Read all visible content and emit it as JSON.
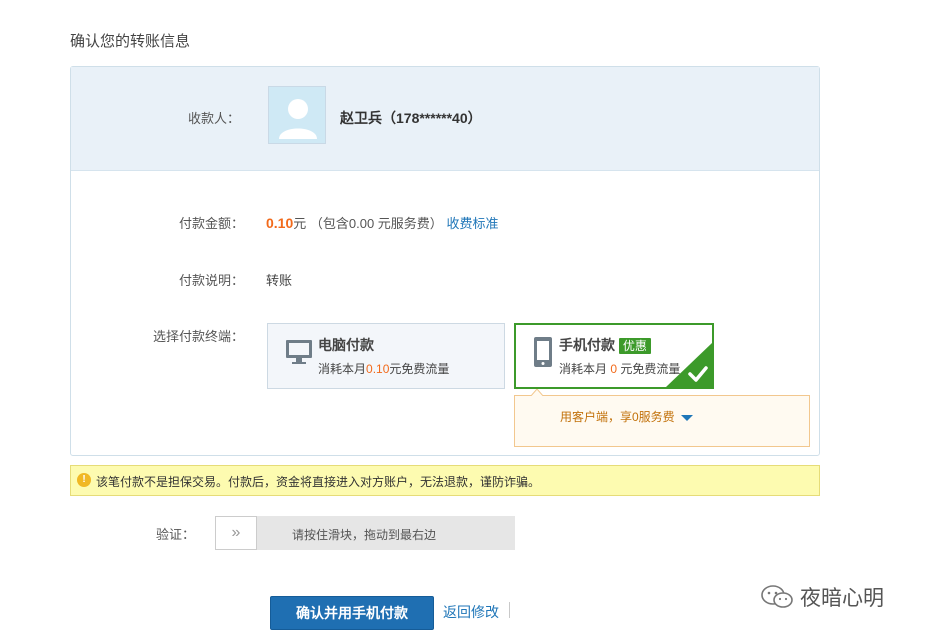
{
  "page": {
    "title": "确认您的转账信息"
  },
  "payee": {
    "label": "收款人：",
    "name": "赵卫兵（178******40）"
  },
  "amount": {
    "label": "付款金额：",
    "value": "0.10",
    "unit": "元",
    "fee_note": "（包含0.00 元服务费）",
    "fee_link": "收费标准"
  },
  "note": {
    "label": "付款说明：",
    "value": "转账"
  },
  "terminal": {
    "label": "选择付款终端：",
    "options": [
      {
        "title": "电脑付款",
        "sub_prefix": "消耗本月",
        "sub_value": "0.10",
        "sub_suffix": "元免费流量",
        "selected": false,
        "icon": "monitor-icon"
      },
      {
        "title": "手机付款",
        "badge": "优惠",
        "sub_prefix": "消耗本月",
        "sub_value": "0",
        "sub_suffix": "元免费流量",
        "selected": true,
        "icon": "phone-icon"
      }
    ],
    "tip": "用客户端，享0服务费"
  },
  "warning": {
    "icon": "warning-icon",
    "text": "该笔付款不是担保交易。付款后，资金将直接进入对方账户，无法退款，谨防诈骗。"
  },
  "verify": {
    "label": "验证：",
    "handle": "»",
    "hint": "请按住滑块，拖动到最右边"
  },
  "actions": {
    "confirm": "确认并用手机付款",
    "back": "返回修改"
  },
  "watermark": "夜暗心明",
  "colors": {
    "accent_orange": "#f26a1b",
    "link_blue": "#1f76b8",
    "selected_green": "#3c9a2a",
    "button_blue": "#1f6fb2"
  }
}
